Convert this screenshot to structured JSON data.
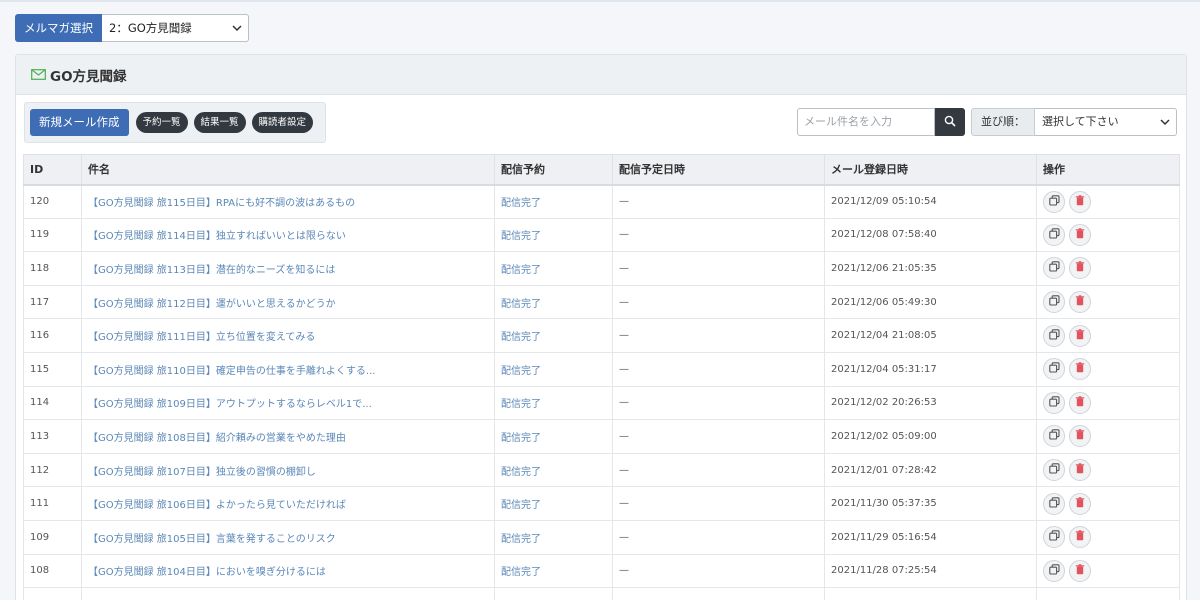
{
  "magazine_select": {
    "label": "メルマガ選択",
    "selected": "2：GO方見聞録"
  },
  "card": {
    "title": "GO方見聞録",
    "icon": "mail-icon"
  },
  "toolbar": {
    "new_mail_label": "新規メール作成",
    "reservation_list_label": "予約一覧",
    "results_list_label": "結果一覧",
    "subscriber_settings_label": "購読者設定"
  },
  "search": {
    "placeholder": "メール件名を入力"
  },
  "sort": {
    "label": "並び順：",
    "selected": "選択して下さい"
  },
  "table": {
    "headers": {
      "id": "ID",
      "subject": "件名",
      "reservation": "配信予約",
      "scheduled": "配信予定日時",
      "registered": "メール登録日時",
      "ops": "操作"
    },
    "rows": [
      {
        "id": "120",
        "subject": "【GO方見聞録 旅115日目】RPAにも好不調の波はあるもの",
        "status": "配信完了",
        "scheduled": "—",
        "registered": "2021/12/09 05:10:54"
      },
      {
        "id": "119",
        "subject": "【GO方見聞録 旅114日目】独立すればいいとは限らない",
        "status": "配信完了",
        "scheduled": "—",
        "registered": "2021/12/08 07:58:40"
      },
      {
        "id": "118",
        "subject": "【GO方見聞録 旅113日目】潜在的なニーズを知るには",
        "status": "配信完了",
        "scheduled": "—",
        "registered": "2021/12/06 21:05:35"
      },
      {
        "id": "117",
        "subject": "【GO方見聞録 旅112日目】運がいいと思えるかどうか",
        "status": "配信完了",
        "scheduled": "—",
        "registered": "2021/12/06 05:49:30"
      },
      {
        "id": "116",
        "subject": "【GO方見聞録 旅111日目】立ち位置を変えてみる",
        "status": "配信完了",
        "scheduled": "—",
        "registered": "2021/12/04 21:08:05"
      },
      {
        "id": "115",
        "subject": "【GO方見聞録 旅110日目】確定申告の仕事を手離れよくする...",
        "status": "配信完了",
        "scheduled": "—",
        "registered": "2021/12/04 05:31:17"
      },
      {
        "id": "114",
        "subject": "【GO方見聞録 旅109日目】アウトプットするならレベル1で...",
        "status": "配信完了",
        "scheduled": "—",
        "registered": "2021/12/02 20:26:53"
      },
      {
        "id": "113",
        "subject": "【GO方見聞録 旅108日目】紹介頼みの営業をやめた理由",
        "status": "配信完了",
        "scheduled": "—",
        "registered": "2021/12/02 05:09:00"
      },
      {
        "id": "112",
        "subject": "【GO方見聞録 旅107日目】独立後の習慣の棚卸し",
        "status": "配信完了",
        "scheduled": "—",
        "registered": "2021/12/01 07:28:42"
      },
      {
        "id": "111",
        "subject": "【GO方見聞録 旅106日目】よかったら見ていただければ",
        "status": "配信完了",
        "scheduled": "—",
        "registered": "2021/11/30 05:37:35"
      },
      {
        "id": "109",
        "subject": "【GO方見聞録 旅105日目】言葉を発することのリスク",
        "status": "配信完了",
        "scheduled": "—",
        "registered": "2021/11/29 05:16:54"
      },
      {
        "id": "108",
        "subject": "【GO方見聞録 旅104日目】においを嗅ぎ分けるには",
        "status": "配信完了",
        "scheduled": "—",
        "registered": "2021/11/28 07:25:54"
      },
      {
        "id": "",
        "subject": "",
        "status": "",
        "scheduled": "",
        "registered": ""
      }
    ]
  },
  "colors": {
    "primary": "#3e6db5",
    "link": "#5a87b7",
    "dark_pill": "#333940",
    "delete_icon": "#e0535f"
  }
}
